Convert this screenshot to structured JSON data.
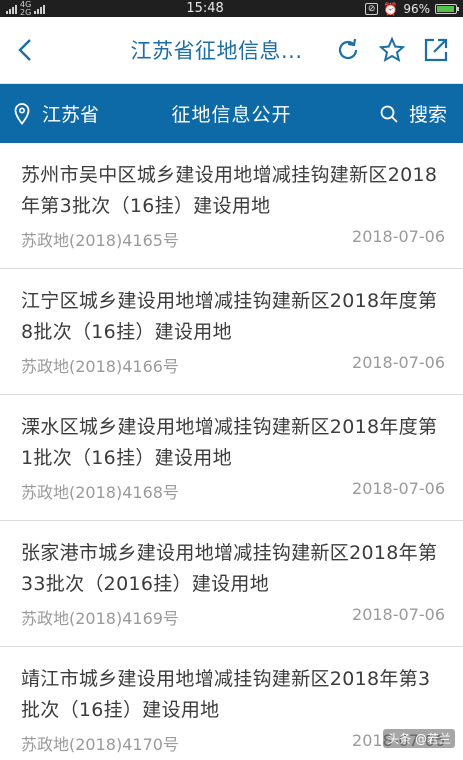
{
  "status_bar": {
    "network_top": "4G",
    "network_bottom": "2G",
    "time": "15:48",
    "battery": "96%",
    "battery_level": 0.96
  },
  "header": {
    "title": "江苏省征地信息...",
    "icons": [
      "back-icon",
      "refresh-icon",
      "star-icon",
      "share-icon"
    ]
  },
  "nav": {
    "location": "江苏省",
    "center": "征地信息公开",
    "search": "搜索"
  },
  "items": [
    {
      "title": "苏州市吴中区城乡建设用地增减挂钩建新区2018年第3批次（16挂）建设用地",
      "doc_no": "苏政地(2018)4165号",
      "date": "2018-07-06"
    },
    {
      "title": "江宁区城乡建设用地增减挂钩建新区2018年度第8批次（16挂）建设用地",
      "doc_no": "苏政地(2018)4166号",
      "date": "2018-07-06"
    },
    {
      "title": "溧水区城乡建设用地增减挂钩建新区2018年度第1批次（16挂）建设用地",
      "doc_no": "苏政地(2018)4168号",
      "date": "2018-07-06"
    },
    {
      "title": "张家港市城乡建设用地增减挂钩建新区2018年第33批次（2016挂）建设用地",
      "doc_no": "苏政地(2018)4169号",
      "date": "2018-07-06"
    },
    {
      "title": "靖江市城乡建设用地增减挂钩建新区2018年第3批次（16挂）建设用地",
      "doc_no": "苏政地(2018)4170号",
      "date": "2018-07-06"
    }
  ],
  "watermark": "头条 @若兰",
  "colors": {
    "accent": "#0e6aa6",
    "title_blue": "#1c6ea4"
  }
}
